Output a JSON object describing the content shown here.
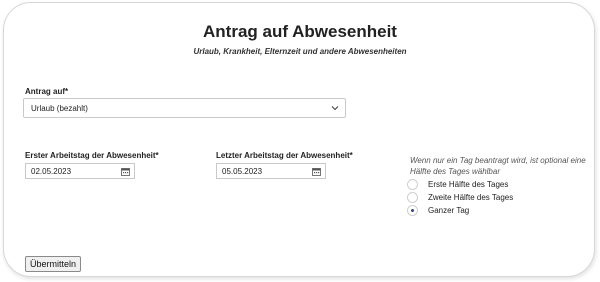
{
  "form": {
    "title": "Antrag auf Abwesenheit",
    "subtitle": "Urlaub, Krankheit, Elternzeit und andere Abwesenheiten",
    "type_label": "Antrag auf*",
    "type_value": "Urlaub (bezahlt)",
    "first_day_label": "Erster Arbeitstag der Abwesenheit*",
    "first_day_value": "02.05.2023",
    "last_day_label": "Letzter Arbeitstag der Abwesenheit*",
    "last_day_value": "05.05.2023",
    "half_day_hint": "Wenn nur ein Tag beantragt wird, ist optional eine Hälfte des Tages wählbar",
    "options": [
      {
        "label": "Erste Hälfte des Tages",
        "checked": false
      },
      {
        "label": "Zweite Hälfte des Tages",
        "checked": false
      },
      {
        "label": "Ganzer Tag",
        "checked": true
      }
    ],
    "submit_label": "Übermitteln"
  },
  "icons": {
    "dropdown": "chevron-down-icon",
    "date_picker": "calendar-icon"
  },
  "colors": {
    "radio_selected": "#2e4b8f",
    "border": "#c9c9c9"
  }
}
